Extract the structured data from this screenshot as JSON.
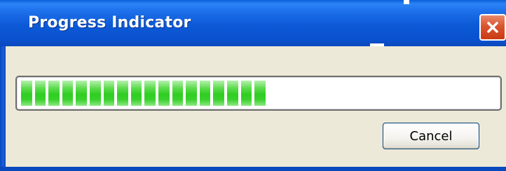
{
  "window": {
    "title": "Progress Indicator",
    "close_icon": "close-icon"
  },
  "progress": {
    "value": 0.51,
    "filled_blocks": 18,
    "fill_color": "#3ad22c"
  },
  "buttons": {
    "cancel_label": "Cancel"
  },
  "colors": {
    "titlebar": "#0a52cf",
    "window_bg": "#ece9d8",
    "close_button": "#d9542f"
  }
}
